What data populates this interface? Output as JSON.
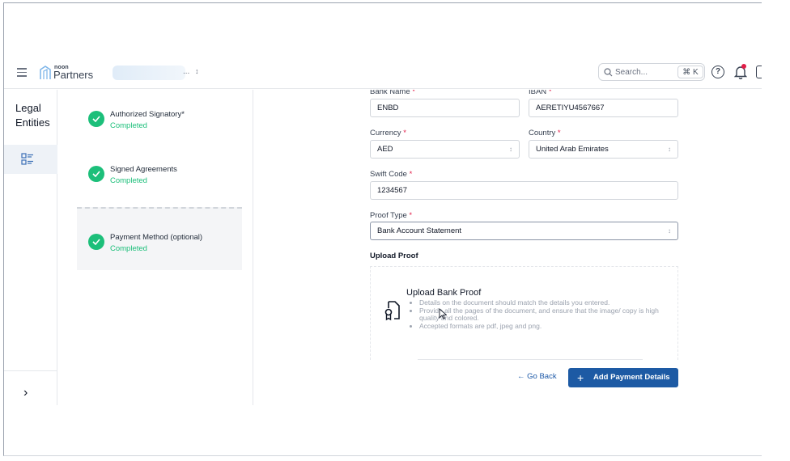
{
  "header": {
    "logo_small": "noon",
    "logo_text": "Partners",
    "store_ellipsis": "...",
    "store_caret": "↕",
    "search_placeholder": "Search...",
    "search_shortcut": "⌘ K",
    "help_glyph": "?"
  },
  "rail": {
    "title_line1": "Legal",
    "title_line2": "Entities",
    "expand_glyph": "›"
  },
  "steps": [
    {
      "title": "Authorized Signatory*",
      "status": "Completed"
    },
    {
      "title": "Signed Agreements",
      "status": "Completed"
    },
    {
      "title": "Payment Method (optional)",
      "status": "Completed"
    }
  ],
  "form": {
    "bank_name_label": "Bank Name",
    "bank_name_value": "ENBD",
    "iban_label": "IBAN",
    "iban_value": "AERETIYU4567667",
    "currency_label": "Currency",
    "currency_value": "AED",
    "country_label": "Country",
    "country_value": "United Arab Emirates",
    "swift_label": "Swift Code",
    "swift_value": "1234567",
    "proof_type_label": "Proof Type",
    "proof_type_value": "Bank Account Statement",
    "required_mark": "*"
  },
  "upload": {
    "section_label": "Upload Proof",
    "title": "Upload Bank Proof",
    "bullets": [
      "Details on the document should match the details you entered.",
      "Provide all the pages of the document, and ensure that the image/ copy is high quality and colored.",
      "Accepted formats are pdf, jpeg and png."
    ]
  },
  "actions": {
    "back_label": "← Go Back",
    "primary_label": "Add Payment Details",
    "primary_plus": "+"
  },
  "colors": {
    "success": "#1cbf7a",
    "primary": "#1d5aa4",
    "required": "#e11d48"
  }
}
